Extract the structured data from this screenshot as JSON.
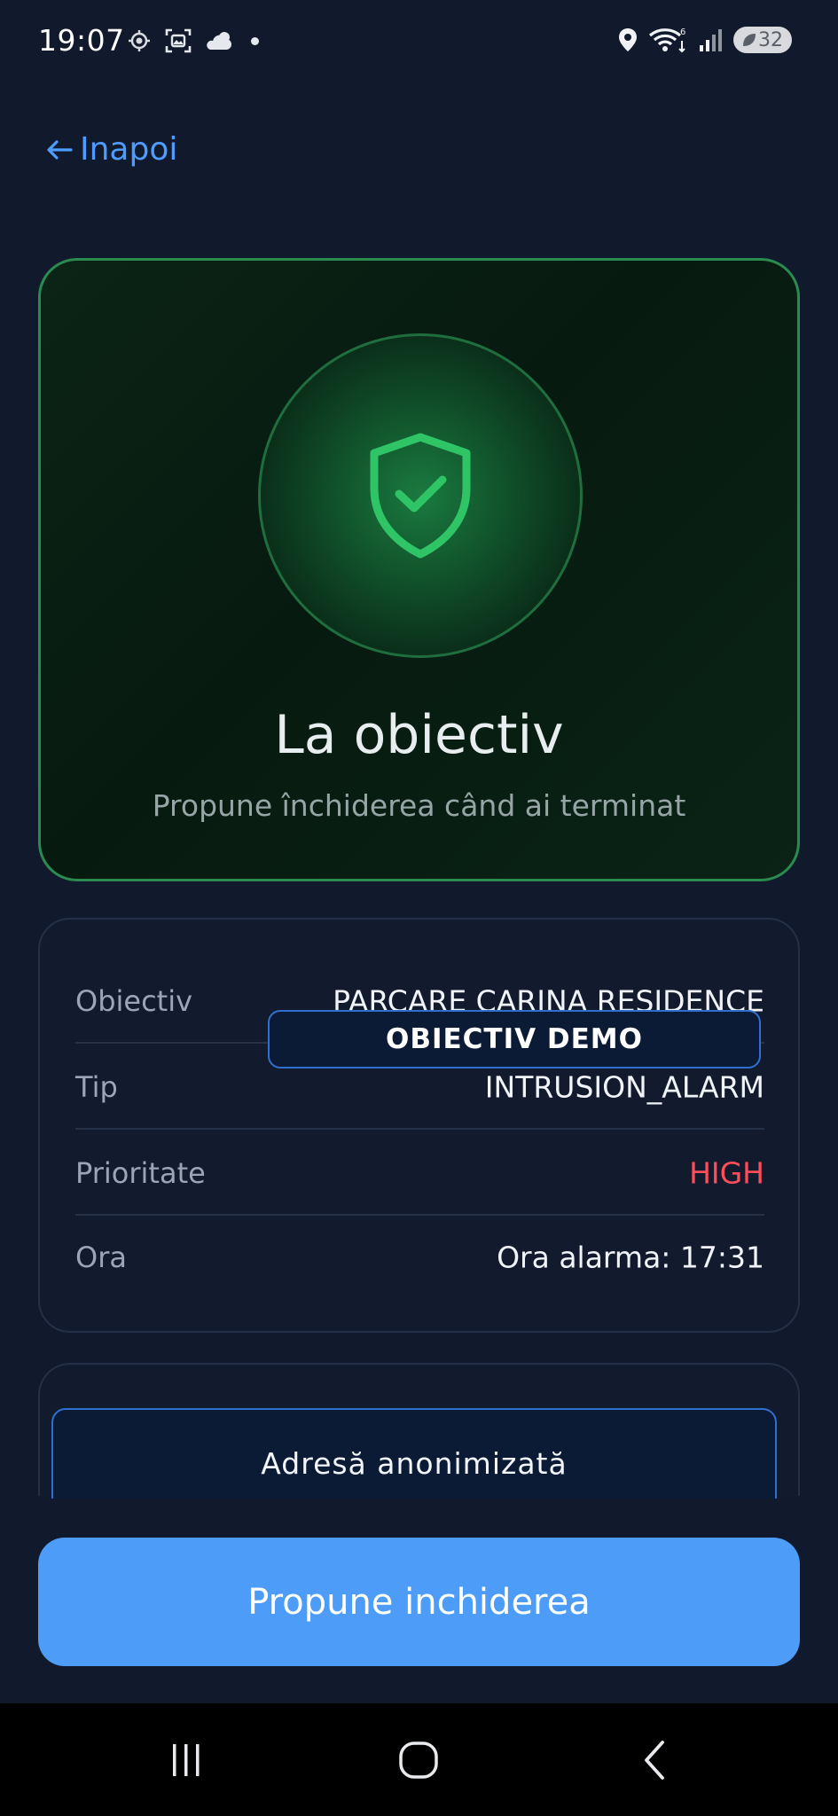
{
  "status_bar": {
    "time": "19:07",
    "battery": "32"
  },
  "header": {
    "back_label": "Inapoi"
  },
  "status_card": {
    "title": "La obiectiv",
    "subtitle": "Propune închiderea când ai terminat",
    "icon": "shield-check-icon",
    "accent_color": "#2fc466"
  },
  "details": {
    "rows": [
      {
        "label": "Obiectiv",
        "value": "PARCARE CARINA RESIDENCE"
      },
      {
        "label": "Tip",
        "value": "INTRUSION_ALARM"
      },
      {
        "label": "Prioritate",
        "value": "HIGH"
      },
      {
        "label": "Ora",
        "value": "Ora alarma: 17:31"
      }
    ],
    "demo_overlay": "OBIECTIV DEMO",
    "priority_color": "#ff4d5a"
  },
  "address": {
    "text": "Adresă anonimizată"
  },
  "actions": {
    "primary_label": "Propune inchiderea",
    "primary_color": "#4d9cf8"
  },
  "nav": {
    "recents": "recents-icon",
    "home": "home-icon",
    "back": "back-icon"
  }
}
